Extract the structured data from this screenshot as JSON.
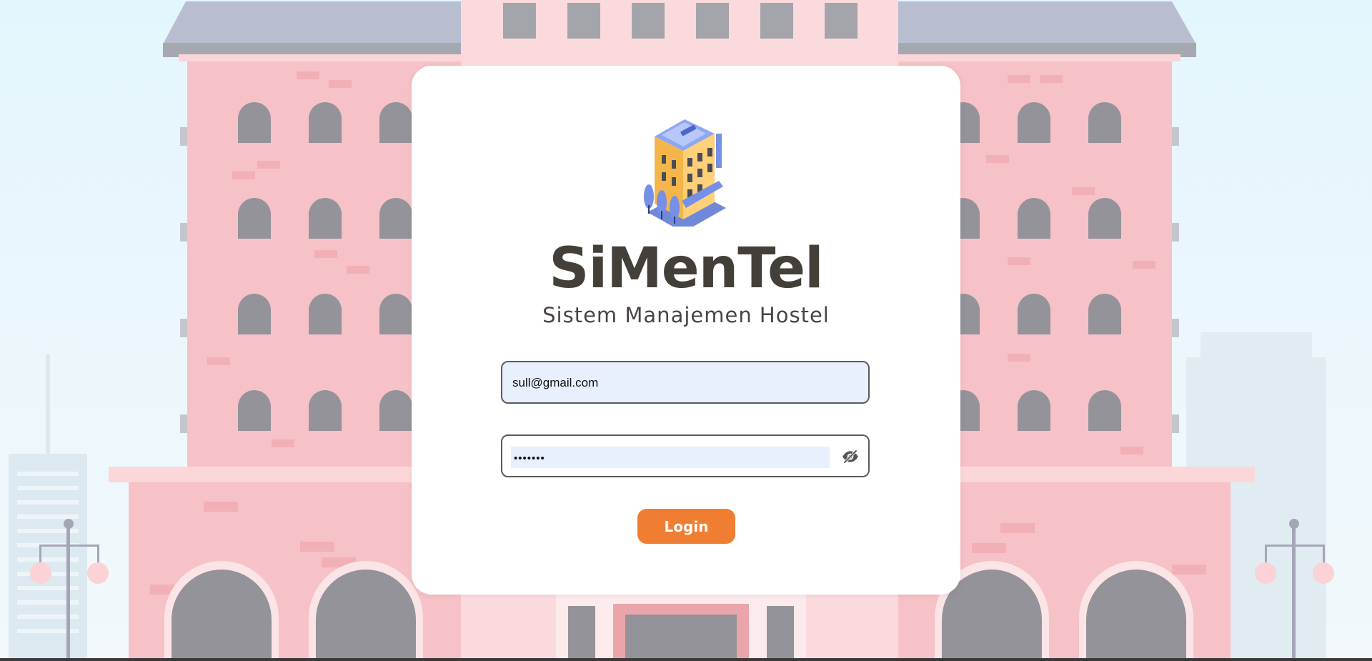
{
  "app": {
    "name": "SiMenTel",
    "tagline": "Sistem Manajemen Hostel"
  },
  "login_form": {
    "email_value": "sull@gmail.com",
    "password_value": "1234567",
    "toggle_icon": "eye-off-icon",
    "submit_label": "Login"
  },
  "colors": {
    "brand_text": "#453f3a",
    "accent": "#f07e32",
    "input_fill": "#e8effd"
  }
}
